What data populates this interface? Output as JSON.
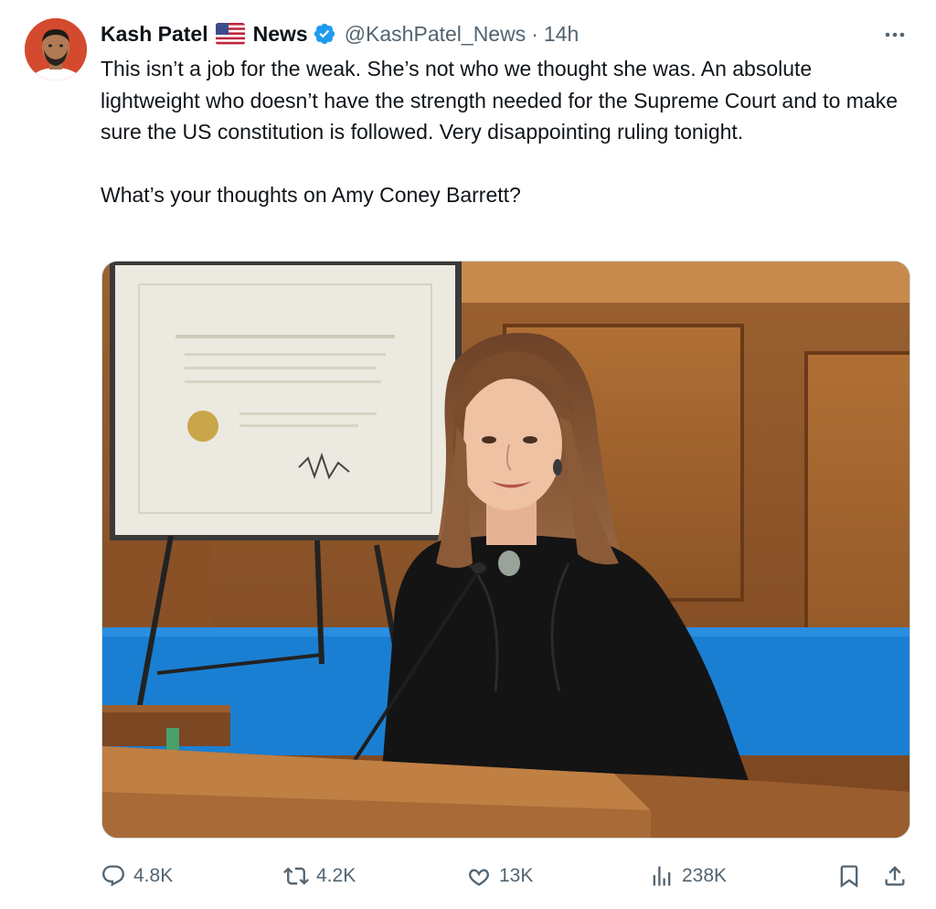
{
  "author": {
    "name": "Kash Patel",
    "flag_icon": "us-flag-icon",
    "name_suffix": "News",
    "verified_icon": "verified-badge-icon",
    "handle": "@KashPatel_News",
    "separator": "·",
    "time": "14h"
  },
  "tweet": {
    "paragraph1": "This isn’t a job for the weak. She’s not who we thought she was. An absolute lightweight who doesn’t have the strength needed for the Supreme Court and to make sure the US constitution is followed. Very disappointing ruling tonight.",
    "paragraph2": "What’s your thoughts on Amy Coney Barrett?"
  },
  "actions": {
    "replies": "4.8K",
    "reposts": "4.2K",
    "likes": "13K",
    "views": "238K"
  },
  "colors": {
    "text": "#0f1419",
    "secondary": "#536471",
    "verified": "#1d9bf0",
    "border": "#cfd9de"
  }
}
